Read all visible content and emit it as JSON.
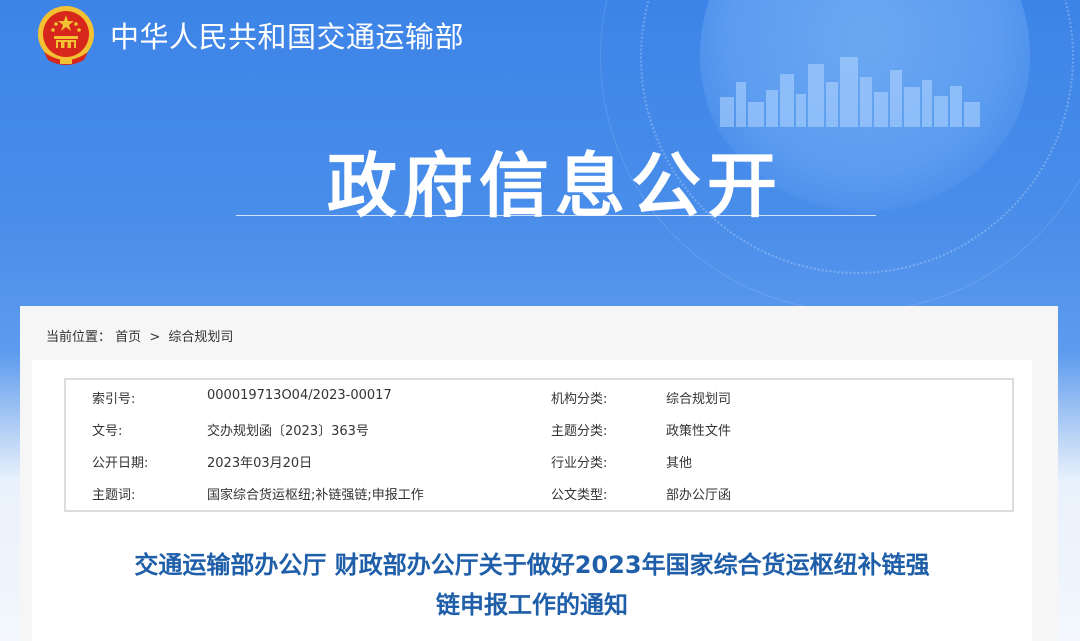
{
  "header": {
    "site_title": "中华人民共和国交通运输部",
    "hero_title": "政府信息公开",
    "emblem_icon": "national-emblem-icon"
  },
  "colors": {
    "banner_blue": "#3d84e8",
    "title_blue": "#1f5ea8",
    "emblem_red": "#d7261b",
    "emblem_gold": "#f3c233"
  },
  "breadcrumb": {
    "label": "当前位置：",
    "home": "首页",
    "separator": ">",
    "current": "综合规划司"
  },
  "meta": {
    "rows": [
      {
        "k1": "索引号:",
        "v1": "000019713O04/2023-00017",
        "k2": "机构分类:",
        "v2": "综合规划司"
      },
      {
        "k1": "文号:",
        "v1": "交办规划函〔2023〕363号",
        "k2": "主题分类:",
        "v2": "政策性文件"
      },
      {
        "k1": "公开日期:",
        "v1": "2023年03月20日",
        "k2": "行业分类:",
        "v2": "其他"
      },
      {
        "k1": "主题词:",
        "v1": "国家综合货运枢纽;补链强链;申报工作",
        "k2": "公文类型:",
        "v2": "部办公厅函"
      }
    ]
  },
  "document": {
    "title_line1": "交通运输部办公厅 财政部办公厅关于做好2023年国家综合货运枢纽补链强",
    "title_line2": "链申报工作的通知"
  }
}
